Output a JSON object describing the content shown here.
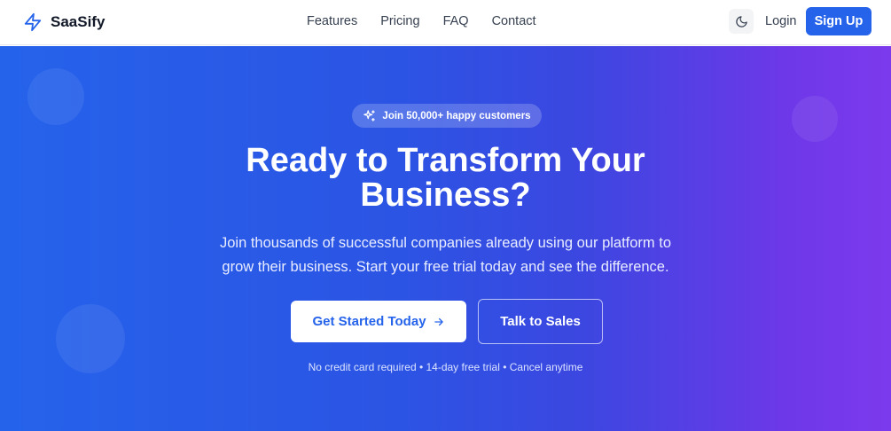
{
  "header": {
    "brand_name": "SaaSify",
    "brand_icon": "lightning-bolt-icon",
    "nav": [
      {
        "label": "Features"
      },
      {
        "label": "Pricing"
      },
      {
        "label": "FAQ"
      },
      {
        "label": "Contact"
      }
    ],
    "theme_toggle_icon": "moon-icon",
    "login_label": "Login",
    "signup_label": "Sign Up"
  },
  "hero": {
    "badge_icon": "sparkles-icon",
    "badge_text": "Join 50,000+ happy customers",
    "title_line1": "Ready to Transform Your",
    "title_line2": "Business?",
    "subtitle_line1": "Join thousands of successful companies already using our platform to",
    "subtitle_line2": "grow their business. Start your free trial today and see the difference.",
    "primary_cta_label": "Get Started Today",
    "primary_cta_icon": "arrow-right-icon",
    "secondary_cta_label": "Talk to Sales",
    "fineprint": "No credit card required • 14-day free trial • Cancel anytime"
  },
  "colors": {
    "brand_blue": "#2563eb",
    "gradient_end_purple": "#7c3aed",
    "text_dark": "#111827",
    "nav_text": "#374151"
  }
}
